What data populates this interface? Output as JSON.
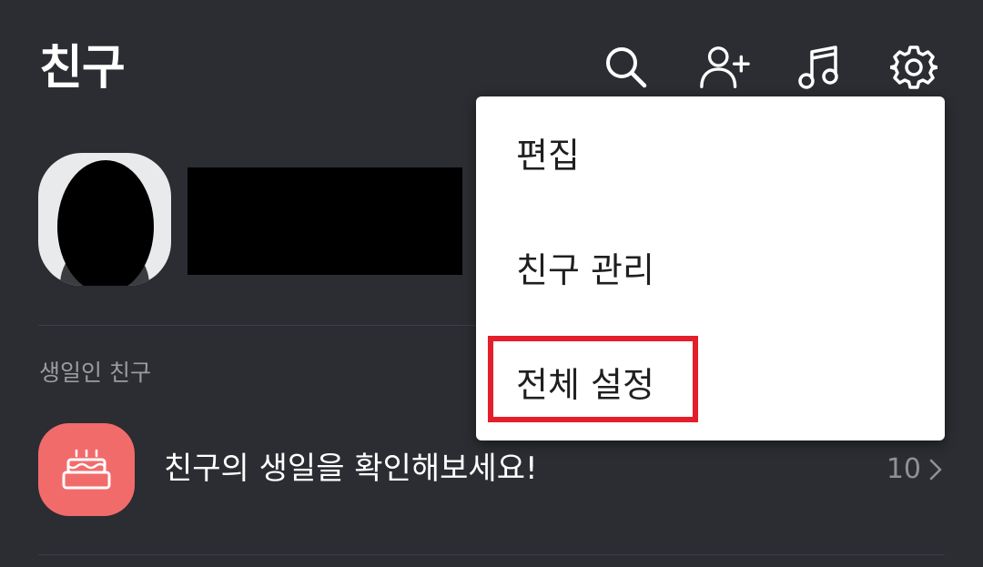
{
  "header": {
    "title": "친구",
    "icons": [
      "search-icon",
      "add-friend-icon",
      "music-icon",
      "gear-icon"
    ]
  },
  "section": {
    "birthday_label": "생일인 친구"
  },
  "birthday_row": {
    "text": "친구의 생일을 확인해보세요!",
    "count": "10",
    "icon": "cake-icon",
    "icon_bg": "#f26b6b"
  },
  "menu": {
    "items": [
      {
        "label": "편집"
      },
      {
        "label": "친구 관리"
      },
      {
        "label": "전체 설정"
      }
    ],
    "highlight_color": "#e41e2b"
  },
  "colors": {
    "background": "#2b2d32",
    "text_primary": "#ffffff",
    "text_secondary": "#9a9ca1"
  }
}
